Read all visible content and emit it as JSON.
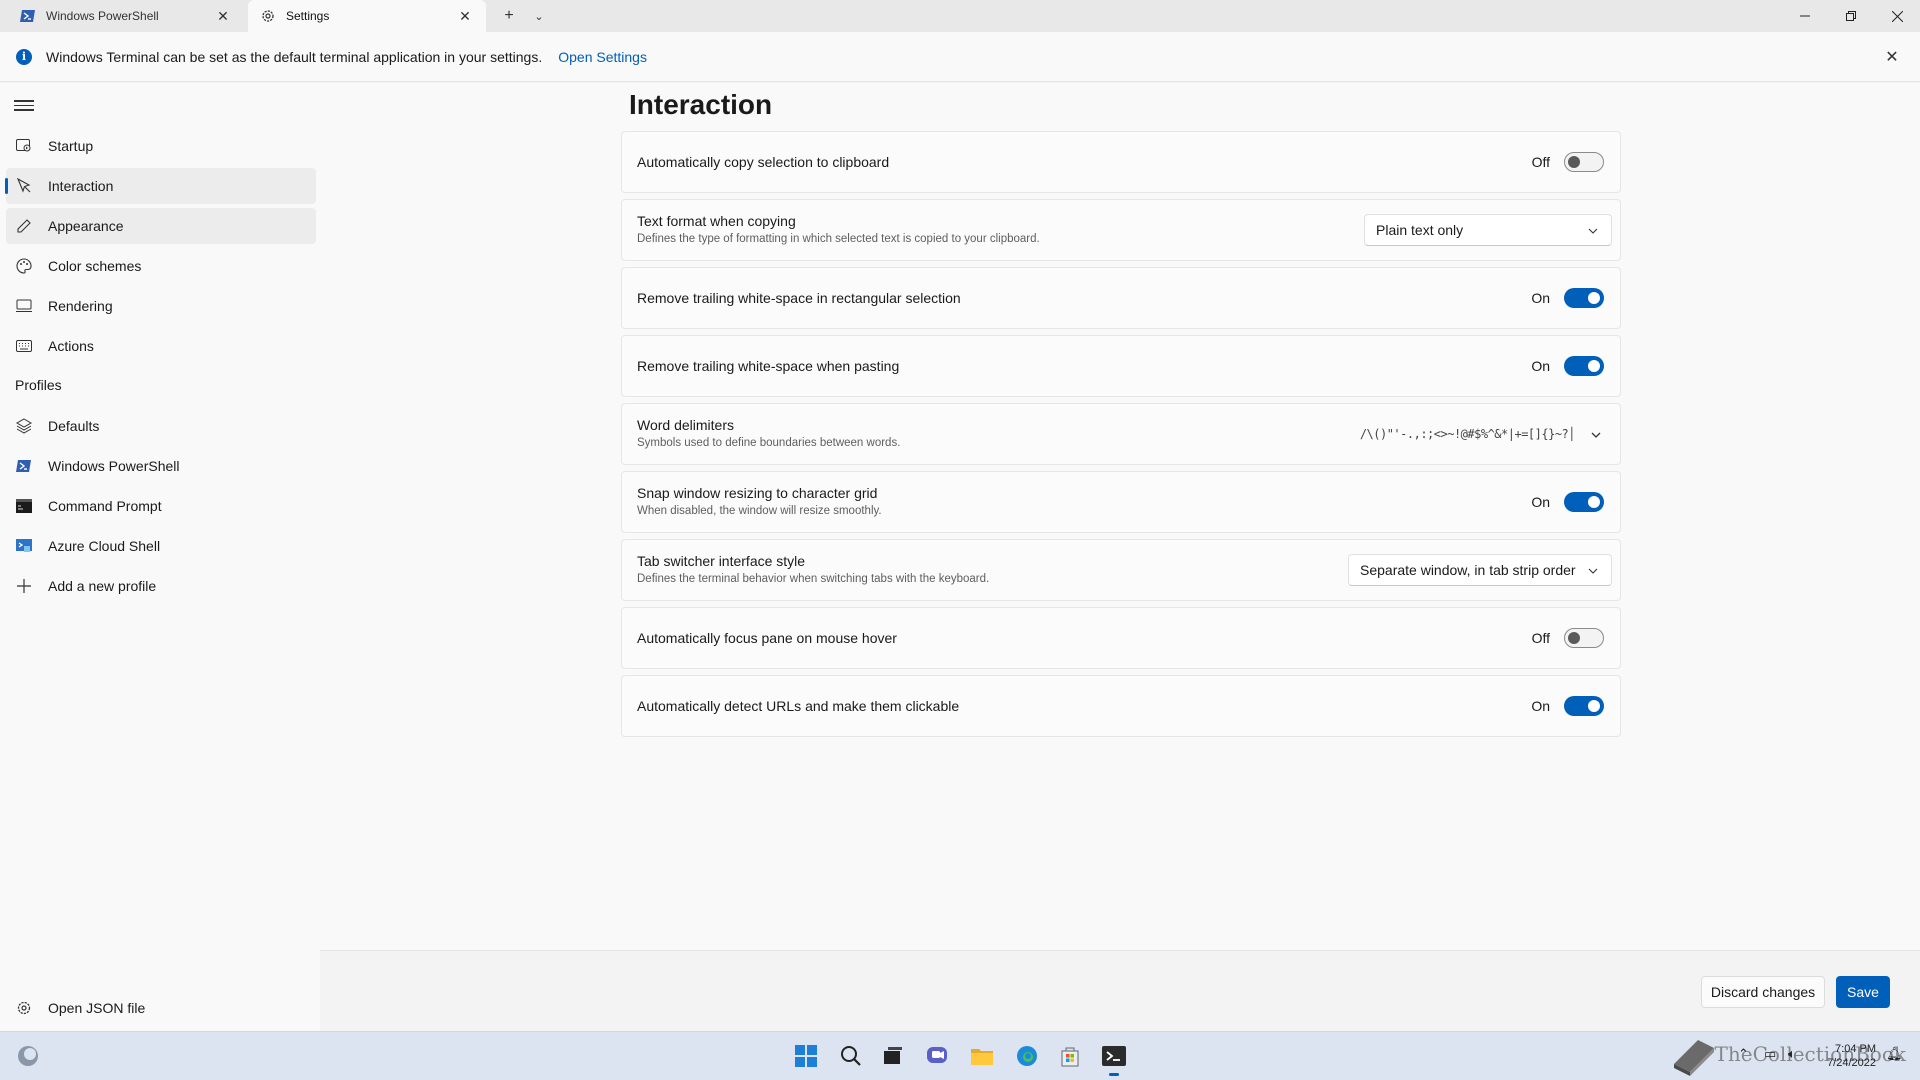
{
  "tabs": [
    {
      "label": "Windows PowerShell",
      "icon": "powershell-icon"
    },
    {
      "label": "Settings",
      "icon": "gear-icon"
    }
  ],
  "infobar": {
    "message": "Windows Terminal can be set as the default terminal application in your settings.",
    "link": "Open Settings"
  },
  "sidebar": {
    "items": [
      {
        "label": "Startup",
        "icon": "startup-icon"
      },
      {
        "label": "Interaction",
        "icon": "interaction-icon"
      },
      {
        "label": "Appearance",
        "icon": "pen-icon"
      },
      {
        "label": "Color schemes",
        "icon": "palette-icon"
      },
      {
        "label": "Rendering",
        "icon": "monitor-icon"
      },
      {
        "label": "Actions",
        "icon": "keyboard-icon"
      }
    ],
    "profiles_header": "Profiles",
    "profiles": [
      {
        "label": "Defaults",
        "icon": "layers-icon"
      },
      {
        "label": "Windows PowerShell",
        "icon": "powershell-icon"
      },
      {
        "label": "Command Prompt",
        "icon": "cmd-icon"
      },
      {
        "label": "Azure Cloud Shell",
        "icon": "azure-icon"
      },
      {
        "label": "Add a new profile",
        "icon": "plus-icon"
      }
    ],
    "open_json": "Open JSON file"
  },
  "page": {
    "title": "Interaction",
    "settings": {
      "copy_on_select": {
        "title": "Automatically copy selection to clipboard",
        "state": "Off"
      },
      "copy_format": {
        "title": "Text format when copying",
        "desc": "Defines the type of formatting in which selected text is copied to your clipboard.",
        "value": "Plain text only"
      },
      "trim_block": {
        "title": "Remove trailing white-space in rectangular selection",
        "state": "On"
      },
      "trim_paste": {
        "title": "Remove trailing white-space when pasting",
        "state": "On"
      },
      "word_delimiters": {
        "title": "Word delimiters",
        "desc": "Symbols used to define boundaries between words.",
        "value": "/\\()\"'-.,:;<>~!@#$%^&*|+=[]{}~?│"
      },
      "snap_resize": {
        "title": "Snap window resizing to character grid",
        "desc": "When disabled, the window will resize smoothly.",
        "state": "On"
      },
      "tab_switcher": {
        "title": "Tab switcher interface style",
        "desc": "Defines the terminal behavior when switching tabs with the keyboard.",
        "value": "Separate window, in tab strip order"
      },
      "focus_follow_mouse": {
        "title": "Automatically focus pane on mouse hover",
        "state": "Off"
      },
      "detect_urls": {
        "title": "Automatically detect URLs and make them clickable",
        "state": "On"
      }
    }
  },
  "footer": {
    "discard": "Discard changes",
    "save": "Save"
  },
  "taskbar": {
    "time": "7:04 PM",
    "date": "7/24/2022",
    "watermark": "TheCollectionBook"
  },
  "colors": {
    "accent": "#005fb8"
  }
}
